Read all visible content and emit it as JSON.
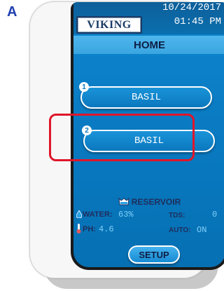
{
  "figure_label": "A",
  "header": {
    "brand": "VIKING",
    "date": "10/24/2017",
    "time": "01:45 PM"
  },
  "page_title": "HOME",
  "zones": [
    {
      "number": "1",
      "label": "BASIL"
    },
    {
      "number": "2",
      "label": "BASIL"
    }
  ],
  "reservoir": {
    "title": "RESERVOIR",
    "water_label": "WATER:",
    "water_value": "63%",
    "tds_label": "TDS:",
    "tds_value": "0",
    "ph_label": "PH:",
    "ph_value": "4.6",
    "auto_label": "AUTO:",
    "auto_value": "ON"
  },
  "setup_label": "SETUP",
  "colors": {
    "screen_blue": "#0a7cc4",
    "highlight_red": "#e0152a"
  },
  "icons": {
    "reservoir": "tank-icon",
    "water": "water-drop-icon",
    "ph": "thermometer-icon"
  }
}
